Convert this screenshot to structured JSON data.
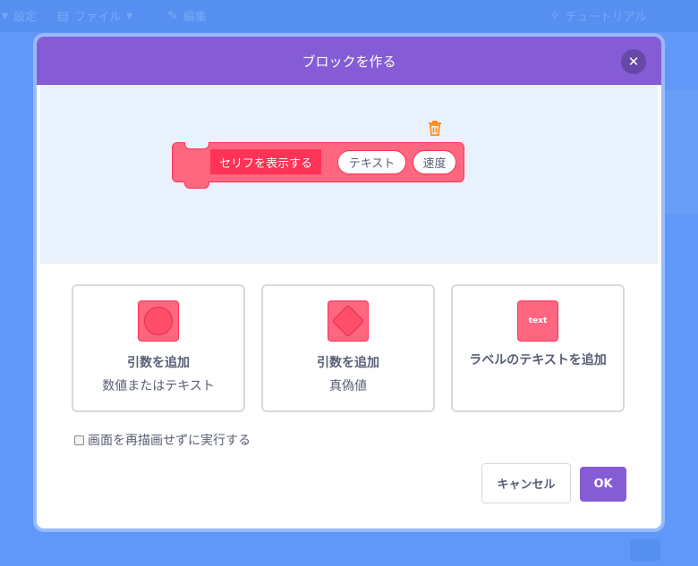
{
  "background": {
    "menu": [
      {
        "label": "設定",
        "icon": "globe-icon"
      },
      {
        "label": "ファイル",
        "icon": "file-icon"
      },
      {
        "label": "編集",
        "icon": "pencil-icon"
      },
      {
        "label": "チュートリアル",
        "icon": "lightbulb-icon"
      }
    ]
  },
  "dialog": {
    "title": "ブロックを作る",
    "close_icon": "close-icon",
    "preview": {
      "label_text": "セリフを表示する",
      "args": [
        "テキスト",
        "速度"
      ],
      "delete_icon": "trash-icon"
    },
    "options": [
      {
        "title": "引数を追加",
        "subtitle": "数値またはテキスト",
        "icon": "round-input-icon"
      },
      {
        "title": "引数を追加",
        "subtitle": "真偽値",
        "icon": "boolean-input-icon"
      },
      {
        "title": "ラベルのテキストを追加",
        "subtitle": "",
        "icon": "text-label-icon",
        "icon_text": "text"
      }
    ],
    "run_without_refresh": {
      "label": "画面を再描画せずに実行する",
      "checked": false
    },
    "buttons": {
      "cancel": "キャンセル",
      "ok": "OK"
    }
  },
  "colors": {
    "header": "#855cd6",
    "block": "#ff6680",
    "block_border": "#ff3355",
    "preview_bg": "#e9f1fc",
    "trash": "#ff8c1a"
  }
}
